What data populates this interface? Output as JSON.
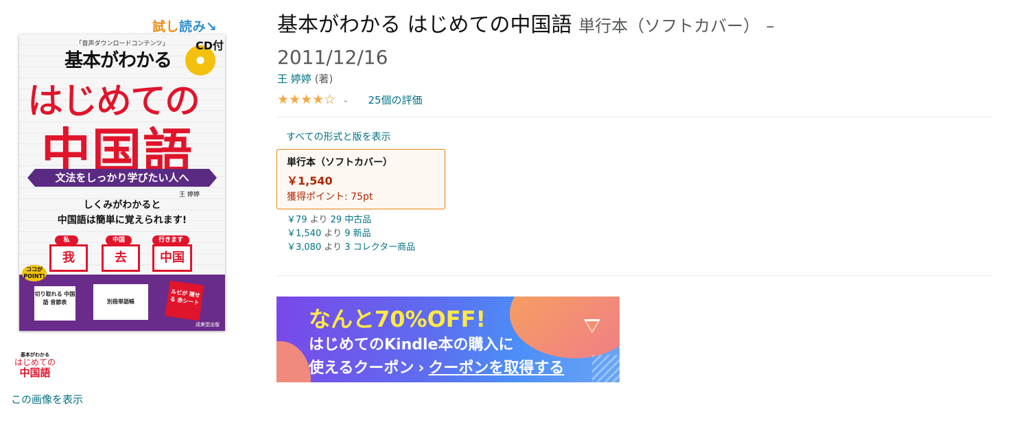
{
  "left": {
    "trial_read_1": "試し",
    "trial_read_2": "読み↘",
    "cover": {
      "subtitle": "「音声ダウンロードコンテンツ」",
      "base": "基本がわかる",
      "cd": "CD付",
      "hajimete": "はじめての",
      "chugokugo": "中国語",
      "ribbon": "文法をしっかり学びたい人へ",
      "author": "王 婷婷",
      "desc1": "しくみがわかると",
      "desc2": "中国語は簡単に覚えられます!",
      "tag1": "私",
      "tag2": "中国",
      "tag3": "行きます",
      "box1": "我",
      "box2": "去",
      "box3": "中国",
      "point": "ココが POINT!",
      "card1": "切り取れる 中国語 音節表",
      "card2": "別冊単語帳",
      "card3": "ルビが 隠せる 赤シート",
      "publisher": "成美堂出版"
    },
    "thumb": {
      "line1": "基本がわかる",
      "line2": "はじめての",
      "line3": "中国語"
    },
    "view_image": "この画像を表示"
  },
  "product": {
    "title": "基本がわかる はじめての中国語",
    "format": "単行本（ソフトカバー）",
    "dash": "–",
    "date": "2011/12/16",
    "author_name": "王 婷婷",
    "author_role": "(著)",
    "stars_filled": "★★★★",
    "stars_empty": "☆",
    "rating_value": 4,
    "rating_count": "25個の評価",
    "chevron": "⌄"
  },
  "formats": {
    "all_link": "すべての形式と版を表示",
    "selected": {
      "name": "単行本（ソフトカバー）",
      "price": "￥1,540",
      "points": "獲得ポイント: 75pt"
    },
    "offers": [
      {
        "price": "￥79",
        "yori": "より",
        "link": "29 中古品"
      },
      {
        "price": "￥1,540",
        "yori": "より",
        "link": "9 新品"
      },
      {
        "price": "￥3,080",
        "yori": "より",
        "link": "3 コレクター商品"
      }
    ]
  },
  "banner": {
    "line1": "なんと70%OFF!",
    "line2": "はじめてのKindle本の購入に",
    "line3a": "使えるクーポン",
    "arrow": "›",
    "line3b": "クーポンを取得する"
  },
  "colors": {
    "link": "#007185",
    "price": "#b12704",
    "star": "#f3a847",
    "format_border": "#e3830b"
  }
}
